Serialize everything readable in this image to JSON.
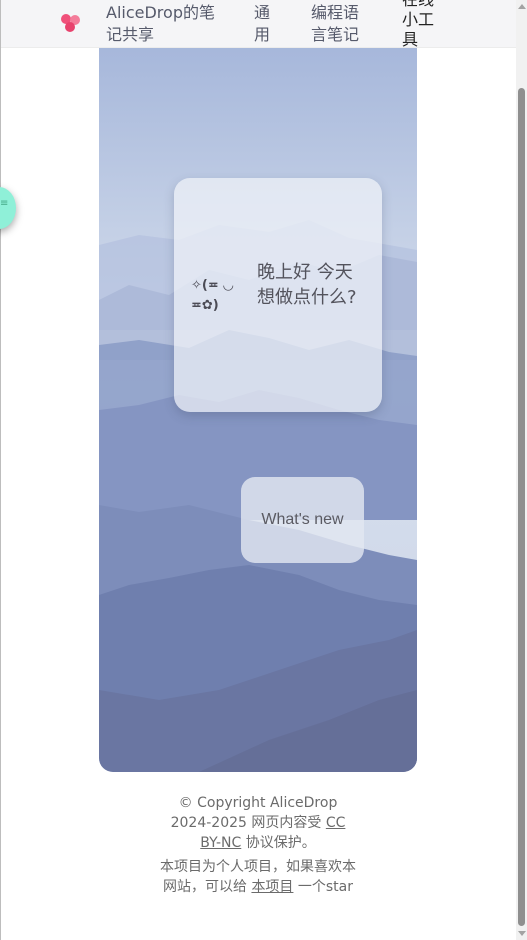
{
  "header": {
    "site_title": "AliceDrop的笔记共享",
    "nav": [
      {
        "label": "通用"
      },
      {
        "label": "编程语言笔记"
      },
      {
        "label": "在线小工具"
      }
    ]
  },
  "hero": {
    "kaomoji": "✧(≖ ◡ ≖✿)",
    "greeting": "晚上好 今天想做点什么?",
    "whats_new_label": "What's new"
  },
  "footer": {
    "copyright_prefix": "© Copyright AliceDrop 2024-2025 网页内容受",
    "license_link": "CC BY-NC",
    "copyright_suffix": "协议保护。",
    "note_prefix": "本项目为个人项目，如果喜欢本网站，可以给",
    "project_link": "本项目",
    "note_suffix": "一个star"
  },
  "colors": {
    "accent_green": "#8ff0d8",
    "logo_pink": "#f0507a"
  }
}
